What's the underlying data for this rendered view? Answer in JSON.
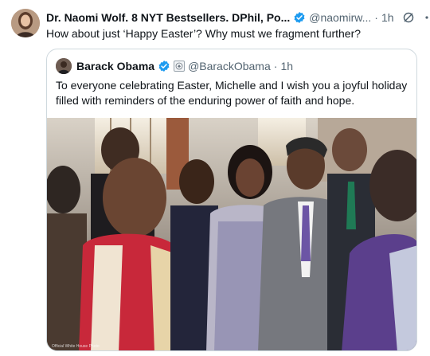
{
  "tweet": {
    "author_name": "Dr. Naomi Wolf. 8 NYT Bestsellers. DPhil, Po...",
    "handle": "@naomirw...",
    "separator": "·",
    "time": "1h",
    "text": "How about just ‘Happy Easter’? Why must we fragment further?",
    "icons": {
      "verified": "verified-badge-icon",
      "grok": "grok-icon",
      "more": "more-icon"
    },
    "colors": {
      "verified": "#1d9bf0",
      "secondary_text": "#536471",
      "border": "#cfd9de"
    }
  },
  "quote": {
    "author_name": "Barack Obama",
    "handle": "@BarackObama",
    "separator": "·",
    "time": "1h",
    "text": "To everyone celebrating Easter, Michelle and I wish you a joyful holiday filled with reminders of the enduring power of faith and hope.",
    "media_credit": "Official White House Photo"
  }
}
